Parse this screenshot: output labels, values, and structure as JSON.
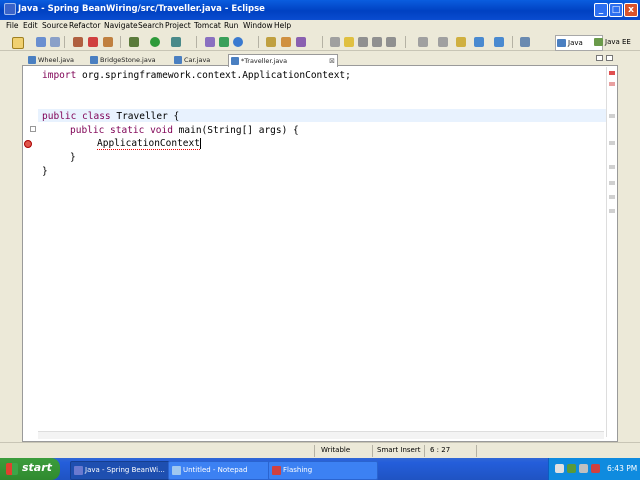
{
  "window": {
    "title": "Java - Spring BeanWiring/src/Traveller.java - Eclipse",
    "controls": {
      "minimize": "_",
      "maximize": "□",
      "close": "x"
    }
  },
  "menu": [
    "File",
    "Edit",
    "Source",
    "Refactor",
    "Navigate",
    "Search",
    "Project",
    "Tomcat",
    "Run",
    "Window",
    "Help"
  ],
  "perspectives": {
    "java": "Java",
    "javaee": "Java EE"
  },
  "editor": {
    "tabs": [
      "Wheel.java",
      "BridgeStone.java",
      "Car.java",
      "*Traveller.java"
    ],
    "active_tab_close": "⊠",
    "code": {
      "import_kw": "import",
      "import_rest": " org.springframework.context.ApplicationContext;",
      "class_kw": "public class",
      "class_rest": " Traveller {",
      "method_kw1": "public static void",
      "method_rest": " main(String[] args) {",
      "typed": "ApplicationContext",
      "close_inner": "}",
      "close_outer": "}"
    }
  },
  "status": {
    "writable": "Writable",
    "insert_mode": "Smart Insert",
    "position": "6 : 27"
  },
  "taskbar": {
    "start": "start",
    "tasks": [
      "Java - Spring BeanWi...",
      "Untitled - Notepad",
      "Flashing"
    ],
    "clock": "6:43 PM"
  },
  "colors": {
    "keyword": "#7f0055",
    "titlebar": "#0041c2",
    "taskbar": "#245edb",
    "start": "#3c9d3c"
  }
}
